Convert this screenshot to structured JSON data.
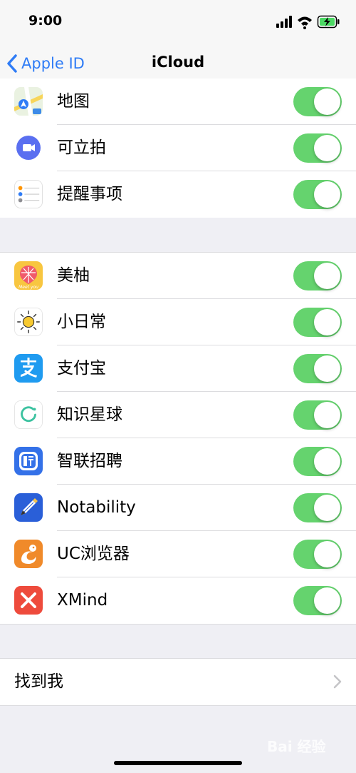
{
  "status_bar": {
    "time": "9:00"
  },
  "nav": {
    "back_label": "Apple ID",
    "title": "iCloud"
  },
  "group1": [
    {
      "label": "地图",
      "icon": "maps-icon",
      "enabled": true
    },
    {
      "label": "可立拍",
      "icon": "clips-icon",
      "enabled": true
    },
    {
      "label": "提醒事项",
      "icon": "reminders-icon",
      "enabled": true
    }
  ],
  "group2": [
    {
      "label": "美柚",
      "icon": "meiyou-icon",
      "enabled": true
    },
    {
      "label": "小日常",
      "icon": "xiaorichang-icon",
      "enabled": true
    },
    {
      "label": "支付宝",
      "icon": "alipay-icon",
      "enabled": true
    },
    {
      "label": "知识星球",
      "icon": "zhishixingqiu-icon",
      "enabled": true
    },
    {
      "label": "智联招聘",
      "icon": "zhilian-icon",
      "enabled": true
    },
    {
      "label": "Notability",
      "icon": "notability-icon",
      "enabled": true
    },
    {
      "label": "UC浏览器",
      "icon": "uc-browser-icon",
      "enabled": true
    },
    {
      "label": "XMind",
      "icon": "xmind-icon",
      "enabled": true
    }
  ],
  "find_my": {
    "label": "找到我"
  },
  "watermark": "Bai 经验",
  "colors": {
    "accent": "#2f7cf6",
    "toggle_on": "#65d36e"
  }
}
